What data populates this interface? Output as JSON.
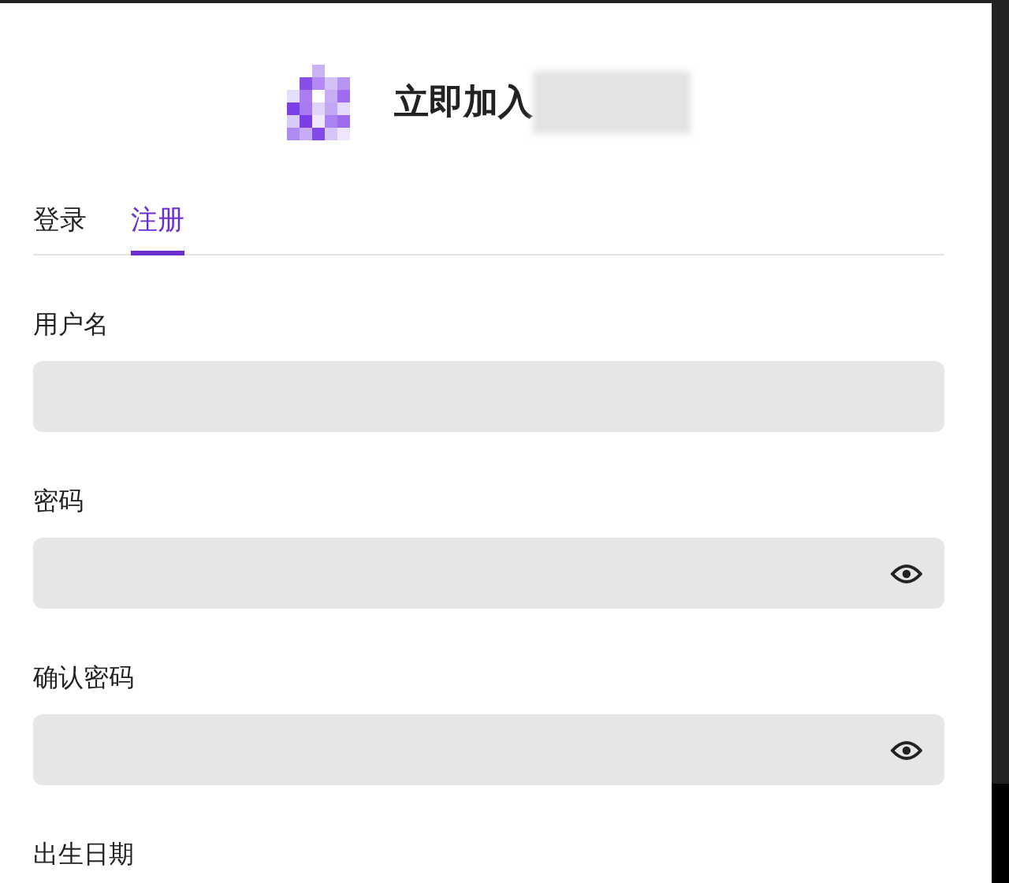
{
  "header": {
    "title": "立即加入"
  },
  "tabs": [
    {
      "label": "登录",
      "selected": false
    },
    {
      "label": "注册",
      "selected": true
    }
  ],
  "fields": [
    {
      "label": "用户名",
      "kind": "text"
    },
    {
      "label": "密码",
      "kind": "password"
    },
    {
      "label": "确认密码",
      "kind": "password"
    },
    {
      "label": "出生日期"
    }
  ]
}
